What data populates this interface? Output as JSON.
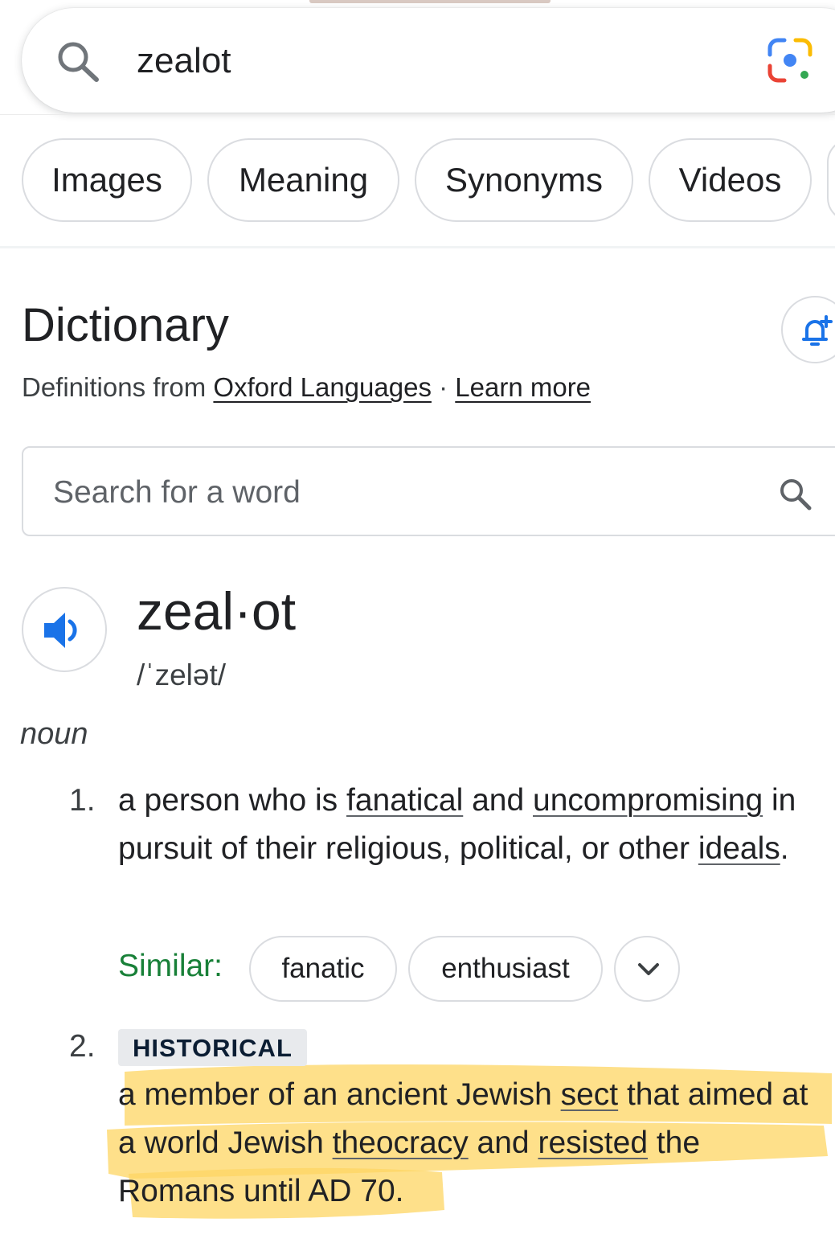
{
  "search": {
    "query": "zealot"
  },
  "chips": [
    "Images",
    "Meaning",
    "Synonyms",
    "Videos"
  ],
  "dictionary": {
    "title": "Dictionary",
    "source_prefix": "Definitions from ",
    "source_link": "Oxford Languages",
    "separator": " · ",
    "learn_more": "Learn more",
    "word_search_placeholder": "Search for a word"
  },
  "entry": {
    "headword": "zeal·ot",
    "phonetic": "/ˈzelət/",
    "part_of_speech": "noun",
    "senses": [
      {
        "number": "1.",
        "segments": [
          "a person who is ",
          "fanatical",
          " and ",
          "uncompromising",
          " in pursuit of their religious, political, or other ",
          "ideals",
          "."
        ],
        "similar_label": "Similar:",
        "similar": [
          "fanatic",
          "enthusiast"
        ]
      },
      {
        "number": "2.",
        "label": "HISTORICAL",
        "segments": [
          "a member of an ancient Jewish ",
          "sect",
          " that aimed at a world Jewish ",
          "theocracy",
          " and ",
          "resisted",
          " the Romans until AD 70."
        ]
      }
    ]
  },
  "colors": {
    "highlight": "#fdd663",
    "similar_label": "#188038",
    "accent_blue": "#1a73e8"
  }
}
